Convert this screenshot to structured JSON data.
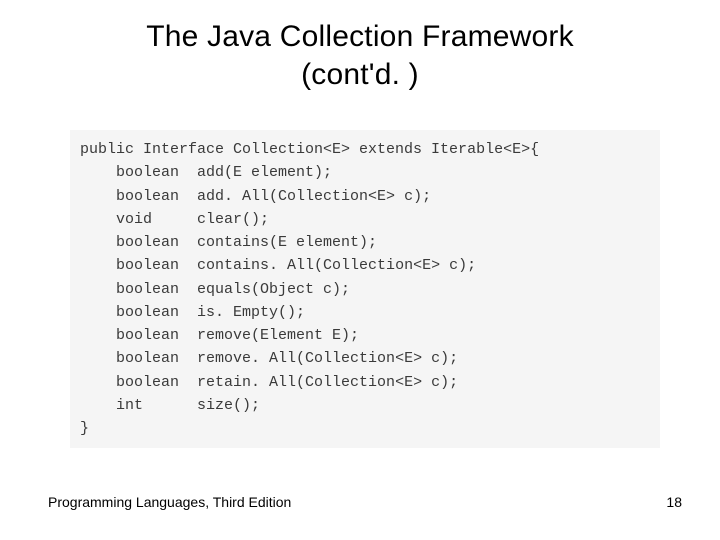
{
  "title_line1": "The Java Collection Framework",
  "title_line2": "(cont'd. )",
  "code": {
    "decl": "public Interface Collection<E> extends Iterable<E>{",
    "members": [
      {
        "return": "boolean",
        "sig": "add(E element);"
      },
      {
        "return": "boolean",
        "sig": "add. All(Collection<E> c);"
      },
      {
        "return": "void",
        "sig": "clear();"
      },
      {
        "return": "boolean",
        "sig": "contains(E element);"
      },
      {
        "return": "boolean",
        "sig": "contains. All(Collection<E> c);"
      },
      {
        "return": "boolean",
        "sig": "equals(Object c);"
      },
      {
        "return": "boolean",
        "sig": "is. Empty();"
      },
      {
        "return": "boolean",
        "sig": "remove(Element E);"
      },
      {
        "return": "boolean",
        "sig": "remove. All(Collection<E> c);"
      },
      {
        "return": "boolean",
        "sig": "retain. All(Collection<E> c);"
      },
      {
        "return": "int",
        "sig": "size();"
      }
    ],
    "close": "}"
  },
  "footer_left": "Programming Languages, Third Edition",
  "page_number": "18"
}
